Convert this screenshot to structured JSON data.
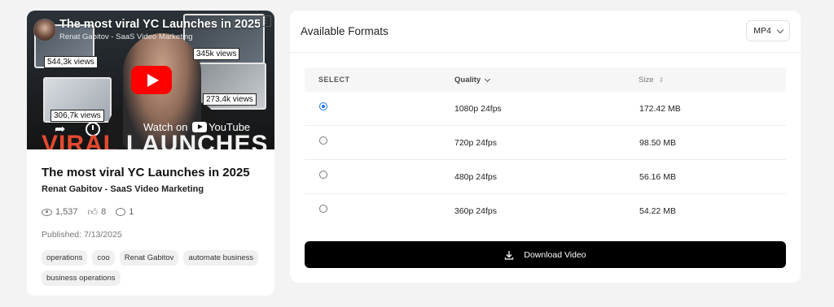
{
  "video": {
    "thumbnail_title": "The most viral YC Launches in 2025",
    "thumbnail_channel": "Renat Gabitov - SaaS Video Marketing",
    "views_tags": [
      "544,3k views",
      "345k views",
      "306,7k views",
      "273,4k views"
    ],
    "watch_on": "Watch on",
    "youtube_text": "YouTube",
    "overlay_word1": "VIRAL",
    "overlay_word2": "LAUNCHES",
    "title": "The most viral YC Launches in 2025",
    "channel": "Renat Gabitov - SaaS Video Marketing",
    "views": "1,537",
    "likes": "8",
    "comments": "1",
    "published": "Published: 7/13/2025",
    "tags": [
      "operations",
      "coo",
      "Renat Gabitov",
      "automate business",
      "business operations"
    ]
  },
  "formats": {
    "title": "Available Formats",
    "selected_format": "MP4",
    "columns": {
      "select": "SELECT",
      "quality": "Quality",
      "size": "Size"
    },
    "rows": [
      {
        "quality": "1080p 24fps",
        "size": "172.42 MB",
        "selected": true
      },
      {
        "quality": "720p 24fps",
        "size": "98.50 MB",
        "selected": false
      },
      {
        "quality": "480p 24fps",
        "size": "56.16 MB",
        "selected": false
      },
      {
        "quality": "360p 24fps",
        "size": "54.22 MB",
        "selected": false
      }
    ],
    "download_label": "Download Video"
  },
  "colors": {
    "accent": "#1a73e8",
    "youtube_red": "#ff0000",
    "button_bg": "#000000"
  },
  "icons": [
    "eye-icon",
    "thumbs-up-icon",
    "comment-icon",
    "chevron-down-icon",
    "sort-icon",
    "download-icon",
    "play-icon",
    "share-icon",
    "clock-icon"
  ]
}
